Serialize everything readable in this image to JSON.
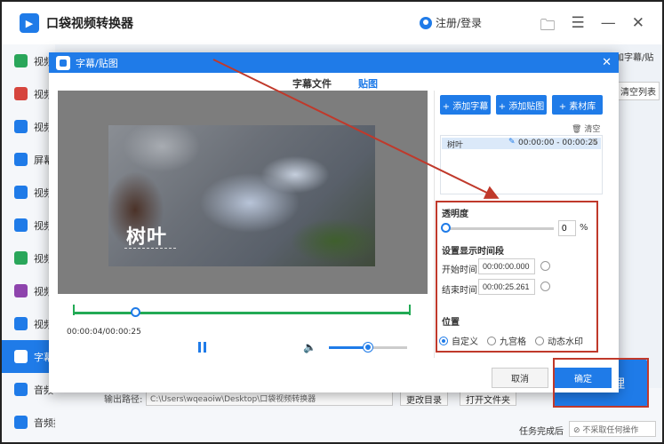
{
  "app": {
    "title": "口袋视频转换器",
    "login": "注册/登录",
    "accent": "#1f7be8",
    "highlight": "#c0392b"
  },
  "sidebar": {
    "items": [
      {
        "label": "视频",
        "color": "#2aa65a"
      },
      {
        "label": "视频",
        "color": "#d6453d"
      },
      {
        "label": "视频",
        "color": "#1f7be8"
      },
      {
        "label": "屏幕",
        "color": "#1f7be8"
      },
      {
        "label": "视频",
        "color": "#1f7be8"
      },
      {
        "label": "视频",
        "color": "#1f7be8"
      },
      {
        "label": "视频",
        "color": "#2aa65a"
      },
      {
        "label": "视频",
        "color": "#8e44ad"
      },
      {
        "label": "视频",
        "color": "#1f7be8"
      },
      {
        "label": "字幕",
        "color": "#1f7be8"
      },
      {
        "label": "音频",
        "color": "#1f7be8"
      },
      {
        "label": "音频提取",
        "color": "#1f7be8"
      }
    ]
  },
  "main": {
    "add_subtitle": "加字幕/贴",
    "clear_list": "清空列表",
    "output_label": "输出路径:",
    "output_path": "C:\\Users\\wqeaoiw\\Desktop\\口袋视频转换器",
    "change_dir": "更改目录",
    "open_folder": "打开文件夹",
    "task_done_label": "任务完成后",
    "task_done_value": "不采取任何操作",
    "process_button": "理"
  },
  "modal": {
    "title": "字幕/贴图",
    "tabs": [
      "字幕文件",
      "贴图"
    ],
    "active_tab": 1,
    "sticker_text": "树叶",
    "current_time": "00:00:04/00:00:25",
    "buttons": {
      "add_subtitle": "+ 添加字幕",
      "add_sticker": "+ 添加贴图",
      "material_lib": "+ 素材库"
    },
    "clear": "清空",
    "list": [
      {
        "name": "树叶",
        "time": "00:00:00 - 00:00:25"
      }
    ],
    "settings": {
      "opacity_label": "透明度",
      "opacity_value": "0",
      "opacity_unit": "%",
      "display_time_label": "设置显示时间段",
      "start_label": "开始时间:",
      "start_value": "00:00:00.000",
      "end_label": "结束时间:",
      "end_value": "00:00:25.261",
      "position_label": "位置",
      "positions": [
        "自定义",
        "九宫格",
        "动态水印"
      ],
      "selected_position": 0
    },
    "cancel": "取消",
    "ok": "确定"
  }
}
